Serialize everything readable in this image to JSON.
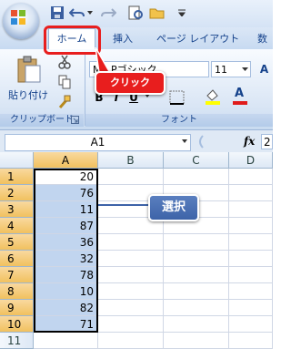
{
  "ribbon": {
    "tabs": [
      "ホーム",
      "挿入",
      "ページ レイアウト",
      "数式"
    ],
    "paste_label": "貼り付け",
    "clipboard_group": "クリップボード",
    "font_group": "フォント",
    "font_name": "MS Pゴシック",
    "font_size": "11",
    "bold": "B",
    "italic": "I",
    "underline": "U",
    "font_color_letter": "A",
    "grow_font": "A"
  },
  "annotations": {
    "click_label": "クリック",
    "select_label": "選択",
    "click_color": "#e81e1e",
    "select_color": "#3d63a8"
  },
  "formula_bar": {
    "name_box": "A1",
    "fx_label": "fx",
    "formula_value": "2"
  },
  "sheet": {
    "columns": [
      "A",
      "B",
      "C",
      "D"
    ],
    "rows": [
      "1",
      "2",
      "3",
      "4",
      "5",
      "6",
      "7",
      "8",
      "9",
      "10",
      "11"
    ],
    "column_a_values": [
      "20",
      "76",
      "11",
      "87",
      "36",
      "32",
      "78",
      "10",
      "82",
      "71",
      ""
    ]
  }
}
